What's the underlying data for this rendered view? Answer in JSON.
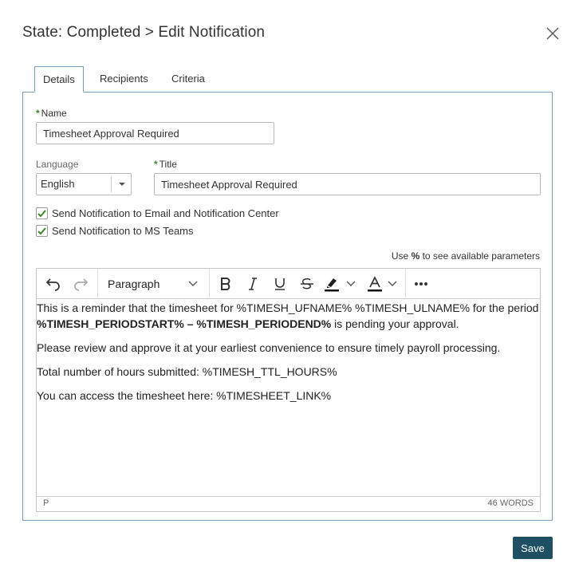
{
  "dialog": {
    "title": "State: Completed > Edit Notification",
    "close_icon": "close-icon"
  },
  "tabs": [
    {
      "label": "Details",
      "active": true
    },
    {
      "label": "Recipients",
      "active": false
    },
    {
      "label": "Criteria",
      "active": false
    }
  ],
  "form": {
    "required_marker": "*",
    "name_label": "Name",
    "name_value": "Timesheet Approval Required",
    "language_label": "Language",
    "language_value": "English",
    "title_label": "Title",
    "title_value": "Timesheet Approval Required",
    "checkboxes": [
      {
        "label": "Send Notification to Email and Notification Center",
        "checked": true
      },
      {
        "label": "Send Notification to MS Teams",
        "checked": true
      }
    ],
    "hint_prefix": "Use ",
    "hint_symbol": "%",
    "hint_suffix": " to see available parameters"
  },
  "editor": {
    "toolbar": {
      "undo_icon": "undo-icon",
      "redo_icon": "redo-icon",
      "block_format": "Paragraph",
      "bold_icon": "bold-icon",
      "italic_icon": "italic-icon",
      "underline_icon": "underline-icon",
      "strikethrough_icon": "strikethrough-icon",
      "highlight_icon": "highlight-icon",
      "text_color_icon": "text-color-icon",
      "more_icon": "more-icon"
    },
    "content": {
      "p1_text": "This is a reminder that the timesheet for %TIMESH_UFNAME% %TIMESH_ULNAME% for the period ",
      "p1_bold": "%TIMESH_PERIODSTART% – %TIMESH_PERIODEND%",
      "p1_end": " is pending your approval.",
      "p2": "Please review and approve it at your earliest convenience to ensure timely payroll processing.",
      "p3": "Total number of hours submitted: %TIMESH_TTL_HOURS%",
      "p4": "You can access the timesheet here: %TIMESHEET_LINK%"
    },
    "status": {
      "path": "P",
      "word_count": "46 WORDS"
    }
  },
  "footer": {
    "save_label": "Save"
  },
  "colors": {
    "save_bg": "#1e4f62",
    "required": "#3a8a2a",
    "panel_border": "#7a9fb6"
  }
}
